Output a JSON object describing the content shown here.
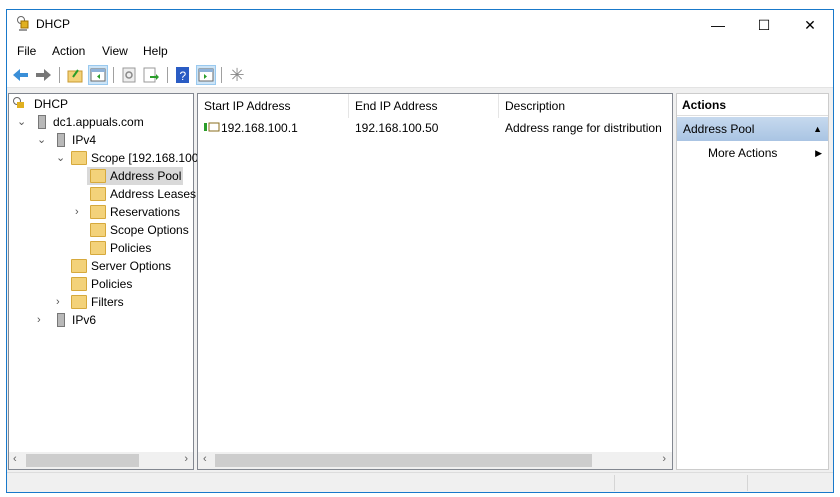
{
  "window": {
    "title": "DHCP",
    "minimize": "—",
    "maximize": "☐",
    "close": "✕"
  },
  "menu": [
    "File",
    "Action",
    "View",
    "Help"
  ],
  "toolbar": [
    "back",
    "forward",
    "up",
    "show-hide-tree",
    "refresh",
    "export",
    "help",
    "show-action-pane",
    "new"
  ],
  "tree": [
    {
      "label": "DHCP",
      "icon": "dhcp-icon"
    },
    {
      "label": "dc1.appuals.com",
      "icon": "server-icon",
      "expanded": true
    },
    {
      "label": "IPv4",
      "icon": "server-check-icon",
      "expanded": true
    },
    {
      "label": "Scope [192.168.100.",
      "icon": "folder-icon",
      "expanded": true
    },
    {
      "label": "Address Pool",
      "icon": "address-pool-icon",
      "selected": true
    },
    {
      "label": "Address Leases",
      "icon": "address-leases-icon"
    },
    {
      "label": "Reservations",
      "icon": "reservations-icon",
      "expanded": false
    },
    {
      "label": "Scope Options",
      "icon": "scope-options-icon"
    },
    {
      "label": "Policies",
      "icon": "policies-icon"
    },
    {
      "label": "Server Options",
      "icon": "server-options-icon"
    },
    {
      "label": "Policies",
      "icon": "policies-icon"
    },
    {
      "label": "Filters",
      "icon": "filters-icon",
      "expanded": false
    },
    {
      "label": "IPv6",
      "icon": "server-check-icon",
      "expanded": false
    }
  ],
  "list": {
    "columns": [
      "Start IP Address",
      "End IP Address",
      "Description"
    ],
    "rows": [
      [
        "192.168.100.1",
        "192.168.100.50",
        "Address range for distribution"
      ]
    ]
  },
  "actions": {
    "header": "Actions",
    "section": "Address Pool",
    "items": [
      "More Actions"
    ]
  }
}
